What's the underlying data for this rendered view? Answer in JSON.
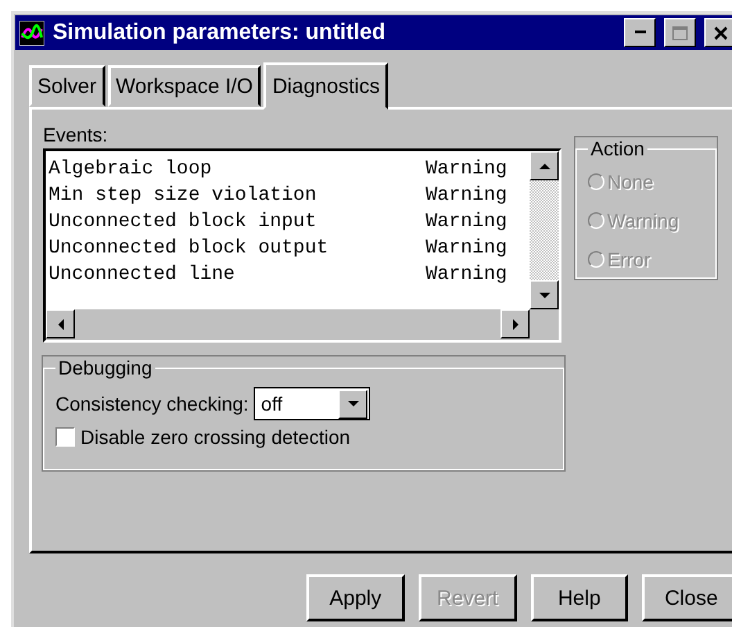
{
  "window": {
    "title": "Simulation parameters: untitled"
  },
  "tabs": [
    {
      "label": "Solver",
      "selected": false
    },
    {
      "label": "Workspace I/O",
      "selected": false
    },
    {
      "label": "Diagnostics",
      "selected": true
    }
  ],
  "events": {
    "label": "Events:",
    "rows": [
      {
        "event": "Algebraic loop",
        "action": "Warning"
      },
      {
        "event": "Min step size violation",
        "action": "Warning"
      },
      {
        "event": "Unconnected block input",
        "action": "Warning"
      },
      {
        "event": "Unconnected block output",
        "action": "Warning"
      },
      {
        "event": "Unconnected line",
        "action": "Warning"
      }
    ]
  },
  "action": {
    "title": "Action",
    "options": [
      {
        "label": "None",
        "selected": false,
        "disabled": true
      },
      {
        "label": "Warning",
        "selected": false,
        "disabled": true
      },
      {
        "label": "Error",
        "selected": false,
        "disabled": true
      }
    ]
  },
  "debugging": {
    "title": "Debugging",
    "consistency_label": "Consistency checking:",
    "consistency_value": "off",
    "zero_crossing_label": "Disable zero crossing detection",
    "zero_crossing_checked": false
  },
  "buttons": [
    {
      "label": "Apply",
      "disabled": false
    },
    {
      "label": "Revert",
      "disabled": true
    },
    {
      "label": "Help",
      "disabled": false
    },
    {
      "label": "Close",
      "disabled": false
    }
  ]
}
